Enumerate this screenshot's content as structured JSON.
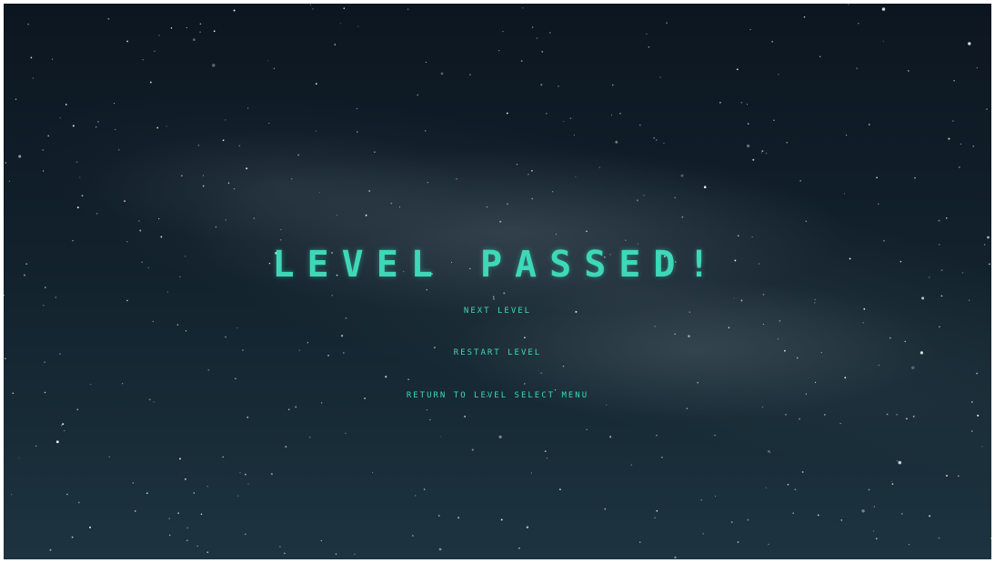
{
  "screen": {
    "title": "LEVEL PASSED!",
    "accent_color": "#3ed8b8"
  },
  "menu": {
    "next_level": "NEXT LEVEL",
    "restart_level": "RESTART LEVEL",
    "return_menu": "RETURN TO LEVEL SELECT MENU"
  }
}
